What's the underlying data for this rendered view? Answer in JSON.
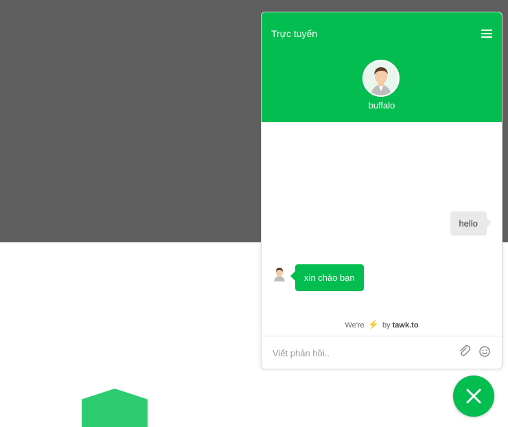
{
  "chat": {
    "status": "Trực tuyến",
    "agent_name": "buffalo",
    "messages": [
      {
        "from": "visitor",
        "text": "hello"
      },
      {
        "from": "agent",
        "text": "xin chào bạn"
      }
    ],
    "branding": {
      "prefix": "We're",
      "middle": "by",
      "brand": "tawk.to"
    },
    "input": {
      "placeholder": "Viết phản hồi.."
    },
    "icons": [
      "menu-icon",
      "agent-avatar",
      "lightning-icon",
      "paperclip-icon",
      "smiley-icon",
      "close-icon"
    ]
  },
  "colors": {
    "accent": "#03bd50",
    "overlay": "#5f5f5f",
    "visitor_bubble": "#e9e9e9",
    "hexagon": "#2ecc71"
  }
}
